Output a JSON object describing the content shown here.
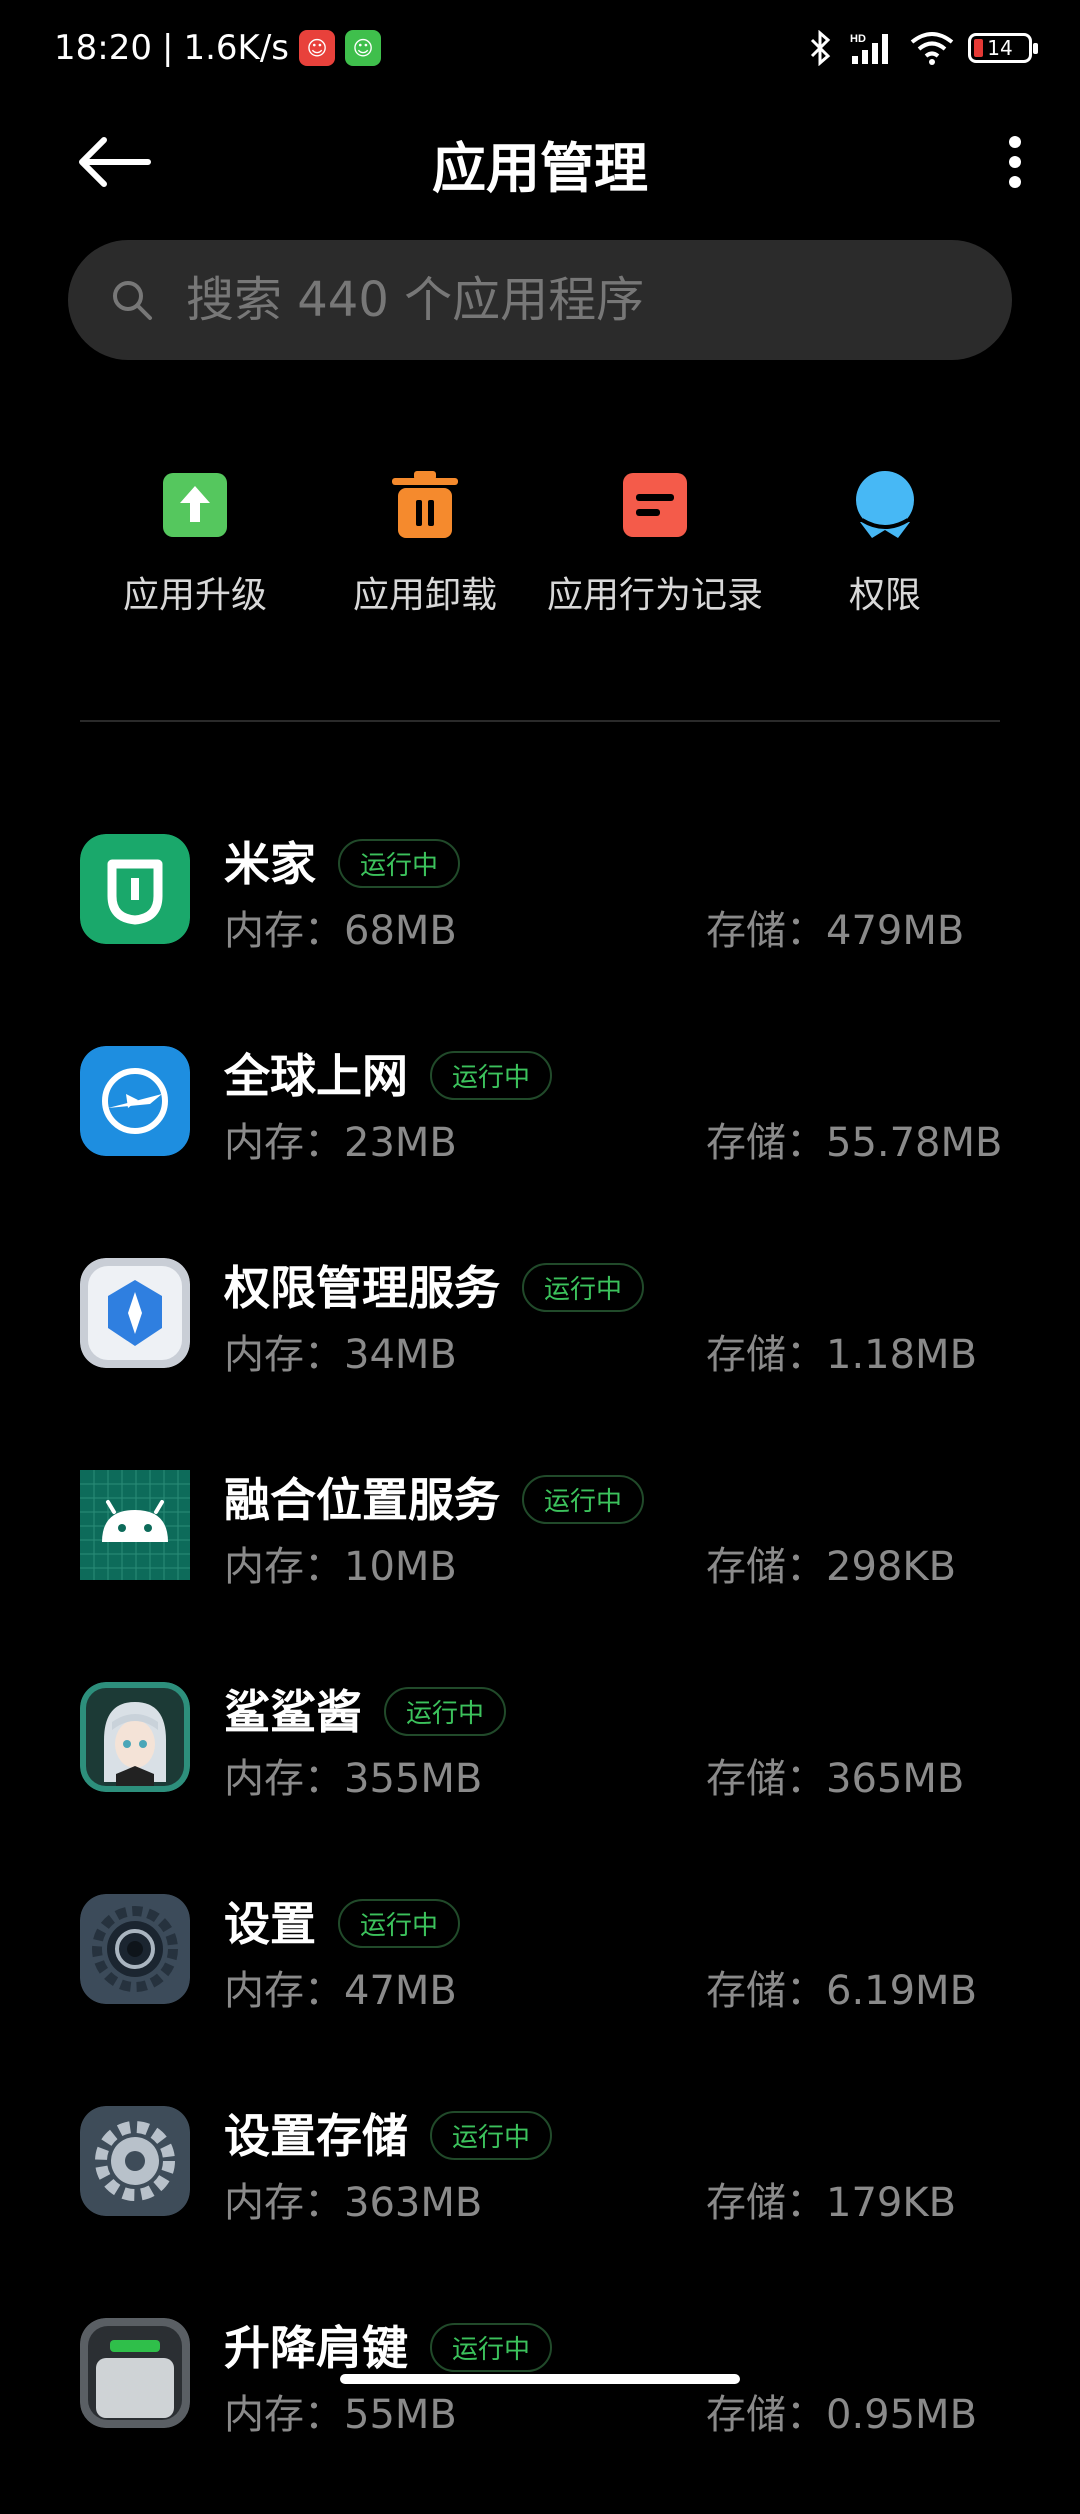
{
  "status_bar": {
    "time": "18:20",
    "separator": "|",
    "net_speed": "1.6K/s",
    "battery": "14",
    "icons": [
      "notification-app-red",
      "notification-app-green",
      "bluetooth-icon",
      "hd-signal-icon",
      "wifi-icon",
      "battery-icon"
    ]
  },
  "header": {
    "title": "应用管理",
    "back_icon": "arrow-left-icon",
    "more_icon": "more-vertical-icon"
  },
  "search": {
    "placeholder": "搜索 440 个应用程序",
    "value": ""
  },
  "quick_actions": [
    {
      "label": "应用升级",
      "icon": "upgrade-icon",
      "color": "#55c75e"
    },
    {
      "label": "应用卸载",
      "icon": "trash-icon",
      "color": "#f58a2d"
    },
    {
      "label": "应用行为记录",
      "icon": "record-icon",
      "color": "#f45b4a"
    },
    {
      "label": "权限",
      "icon": "permission-icon",
      "color": "#47b8f5"
    }
  ],
  "apps": [
    {
      "name": "米家",
      "status": "运行中",
      "memory": "内存：68MB",
      "storage": "存储：479MB"
    },
    {
      "name": "全球上网",
      "status": "运行中",
      "memory": "内存：23MB",
      "storage": "存储：55.78MB"
    },
    {
      "name": "权限管理服务",
      "status": "运行中",
      "memory": "内存：34MB",
      "storage": "存储：1.18MB"
    },
    {
      "name": "融合位置服务",
      "status": "运行中",
      "memory": "内存：10MB",
      "storage": "存储：298KB"
    },
    {
      "name": "鲨鲨酱",
      "status": "运行中",
      "memory": "内存：355MB",
      "storage": "存储：365MB"
    },
    {
      "name": "设置",
      "status": "运行中",
      "memory": "内存：47MB",
      "storage": "存储：6.19MB"
    },
    {
      "name": "设置存储",
      "status": "运行中",
      "memory": "内存：363MB",
      "storage": "存储：179KB"
    },
    {
      "name": "升降肩键",
      "status": "运行中",
      "memory": "内存：55MB",
      "storage": "存储：0.95MB"
    }
  ],
  "colors": {
    "background": "#000000",
    "running_badge": "#3cc25c",
    "secondary_text": "#8a8a8a"
  }
}
